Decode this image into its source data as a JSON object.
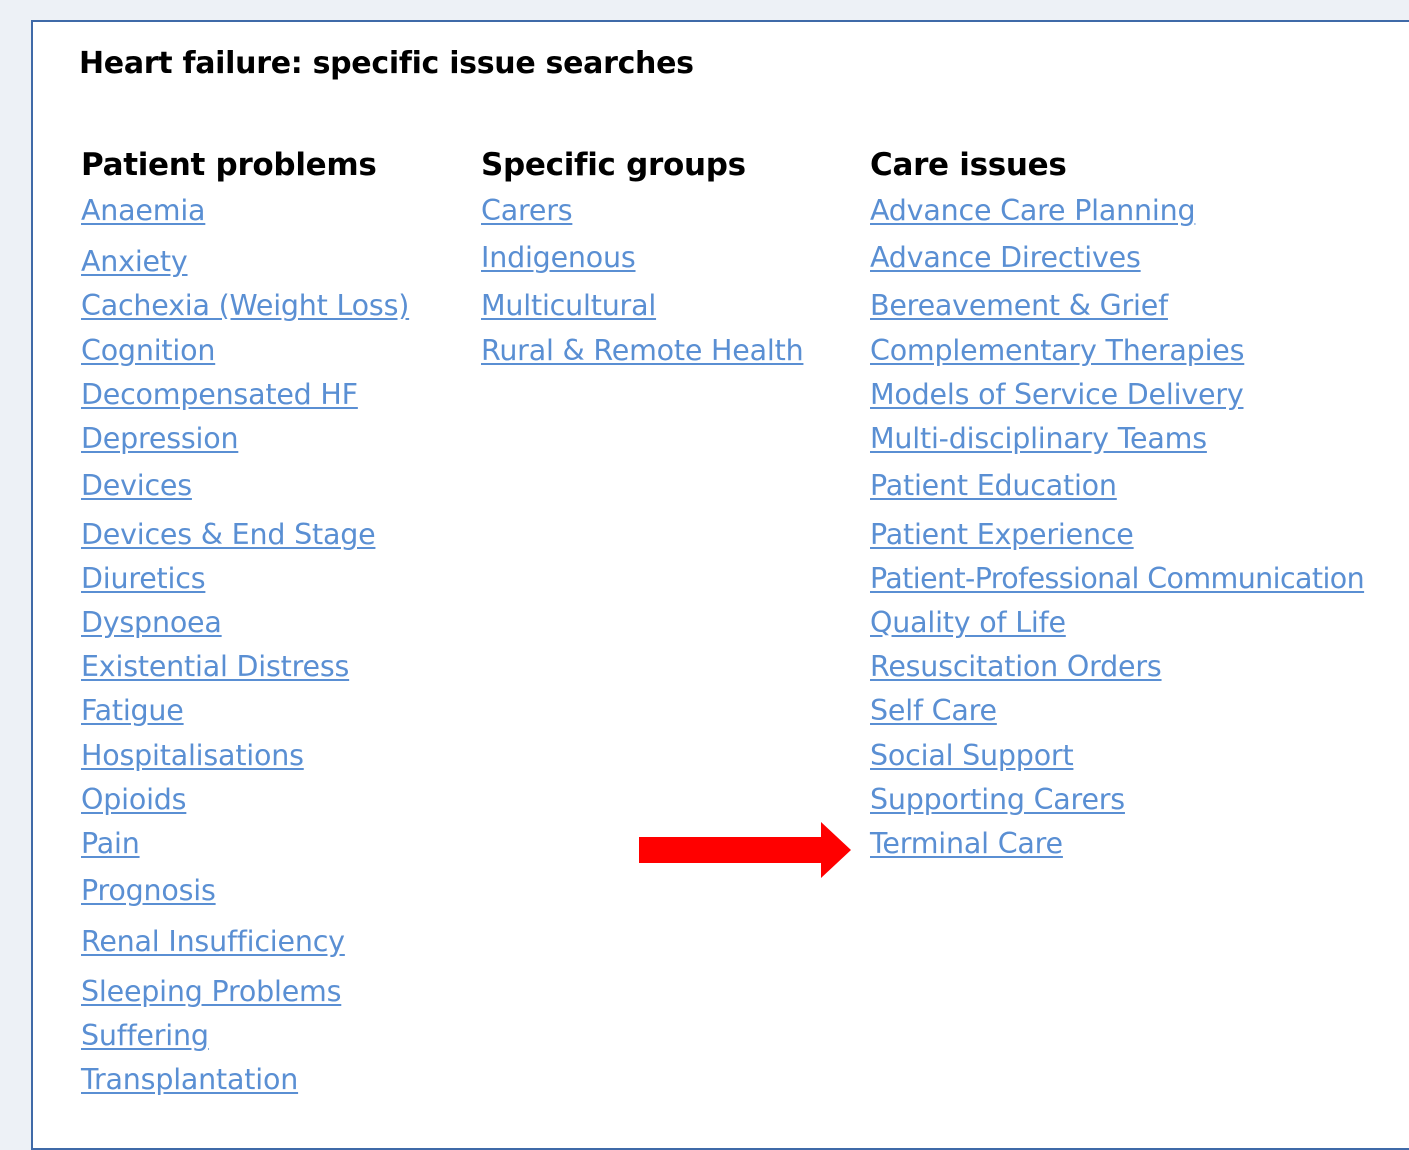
{
  "page": {
    "title": "Heart failure: specific issue searches",
    "link_color": "#5a8fd3",
    "border_color": "#3f6aa8",
    "arrow_color": "#ff0000",
    "arrow_icon": "right-arrow-icon"
  },
  "columns": {
    "patient_problems": {
      "heading": "Patient problems",
      "items": [
        "Anaemia",
        "Anxiety",
        "Cachexia (Weight Loss)",
        "Cognition",
        "Decompensated HF",
        "Depression",
        "Devices",
        "Devices & End Stage",
        "Diuretics",
        "Dyspnoea",
        "Existential Distress",
        "Fatigue",
        "Hospitalisations",
        "Opioids",
        "Pain",
        "Prognosis",
        "Renal Insufficiency",
        "Sleeping Problems",
        "Suffering",
        "Transplantation"
      ]
    },
    "specific_groups": {
      "heading": "Specific groups",
      "items": [
        "Carers",
        "Indigenous",
        "Multicultural",
        "Rural & Remote Health"
      ]
    },
    "care_issues": {
      "heading": "Care issues",
      "items": [
        "Advance Care Planning",
        "Advance Directives",
        "Bereavement & Grief",
        "Complementary Therapies",
        "Models of Service Delivery",
        "Multi-disciplinary Teams",
        "Patient Education",
        "Patient Experience",
        "Patient-Professional Communication",
        "Quality of Life",
        "Resuscitation Orders",
        "Self Care",
        "Social Support",
        "Supporting Carers",
        "Terminal Care"
      ]
    }
  }
}
